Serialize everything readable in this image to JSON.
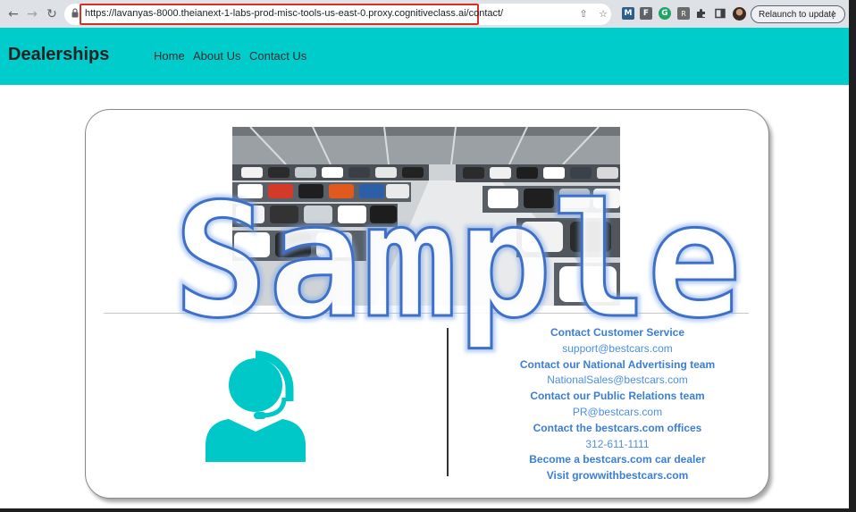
{
  "browser": {
    "url": "https://lavanyas-8000.theianext-1-labs-prod-misc-tools-us-east-0.proxy.cognitiveclass.ai/contact/",
    "relaunch_label": "Relaunch to update",
    "relaunch_menu": "⋮",
    "extensions": [
      "M",
      "F",
      "G",
      "R"
    ]
  },
  "navbar": {
    "brand": "Dealerships",
    "links": [
      "Home",
      "About Us",
      "Contact Us"
    ],
    "background": "#00cccc"
  },
  "contact": {
    "lines": [
      {
        "text": "Contact Customer Service",
        "bold": true
      },
      {
        "text": "support@bestcars.com",
        "bold": false
      },
      {
        "text": "Contact our National Advertising team",
        "bold": true
      },
      {
        "text": "NationalSales@bestcars.com",
        "bold": false
      },
      {
        "text": "Contact our Public Relations team",
        "bold": true
      },
      {
        "text": "PR@bestcars.com",
        "bold": false
      },
      {
        "text": "Contact the bestcars.com offices",
        "bold": true
      },
      {
        "text": "312-611-1111",
        "bold": false
      },
      {
        "text": "Become a bestcars.com car dealer",
        "bold": true
      },
      {
        "text": "Visit growwithbestcars.com",
        "bold": true
      }
    ],
    "link_color": "#4a90e2"
  },
  "watermark": {
    "text": "Sample"
  },
  "icons": {
    "back": "arrow-left-icon",
    "forward": "arrow-right-icon",
    "reload": "reload-icon",
    "lock": "lock-icon",
    "share": "share-icon",
    "bookmark": "star-icon",
    "extensions": "puzzle-icon",
    "side_panel": "side-panel-icon",
    "support": "headset-agent-icon"
  }
}
